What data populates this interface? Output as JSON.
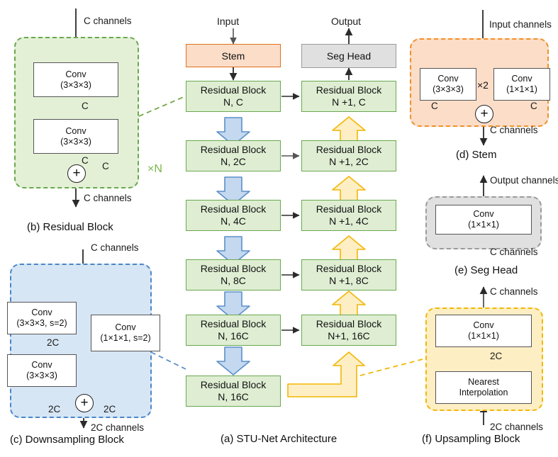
{
  "figure": {
    "title": "STU-Net Architecture figure",
    "colors": {
      "residual_fill": "#dfeed3",
      "residual_border": "#6aa84f",
      "stem_fill": "#fbddc8",
      "stem_border": "#e2701c",
      "seghead_fill": "#e0e0e0",
      "seghead_border": "#9a9a9a",
      "downsample_fill": "#d7e6f5",
      "downsample_border": "#4a86c8",
      "upsample_fill": "#fdeec4",
      "upsample_border": "#f2b705",
      "down_arrow_fill": "#c4d8ef",
      "down_arrow_border": "#5b8fc9",
      "up_arrow_fill": "#fdeec4",
      "up_arrow_border": "#f2b705"
    }
  },
  "panel_b": {
    "caption": "(b) Residual Block",
    "in_label": "C channels",
    "out_label": "C channels",
    "repeat_label": "×N",
    "conv1": {
      "line1": "Conv",
      "line2": "(3×3×3)"
    },
    "conv2": {
      "line1": "Conv",
      "line2": "(3×3×3)"
    },
    "mid1": "C",
    "mid2": "C",
    "skip": "C",
    "add": "+"
  },
  "panel_c": {
    "caption": "(c) Downsampling Block",
    "in_label": "C channels",
    "out_label": "2C channels",
    "conv1": {
      "line1": "Conv",
      "line2": "(3×3×3, s=2)"
    },
    "conv2": {
      "line1": "Conv",
      "line2": "(3×3×3)"
    },
    "conv3": {
      "line1": "Conv",
      "line2": "(1×1×1, s=2)"
    },
    "mid1": "2C",
    "left_join": "2C",
    "right_join": "2C",
    "add": "+"
  },
  "panel_a": {
    "caption": "(a) STU-Net Architecture",
    "input_label": "Input",
    "output_label": "Output",
    "stem_label": "Stem",
    "seghead_label": "Seg Head",
    "encoder": [
      {
        "line1": "Residual Block",
        "line2": "N, C"
      },
      {
        "line1": "Residual Block",
        "line2": "N, 2C"
      },
      {
        "line1": "Residual Block",
        "line2": "N, 4C"
      },
      {
        "line1": "Residual Block",
        "line2": "N, 8C"
      },
      {
        "line1": "Residual Block",
        "line2": "N, 16C"
      },
      {
        "line1": "Residual Block",
        "line2": "N, 16C"
      }
    ],
    "decoder": [
      {
        "line1": "Residual Block",
        "line2": "N +1, C"
      },
      {
        "line1": "Residual Block",
        "line2": "N +1, 2C"
      },
      {
        "line1": "Residual Block",
        "line2": "N +1, 4C"
      },
      {
        "line1": "Residual Block",
        "line2": "N +1, 8C"
      },
      {
        "line1": "Residual Block",
        "line2": "N+1, 16C"
      }
    ]
  },
  "panel_d": {
    "caption": "(d) Stem",
    "in_label": "Input channels",
    "out_label": "C channels",
    "conv_left": {
      "line1": "Conv",
      "line2": "(3×3×3)"
    },
    "conv_right": {
      "line1": "Conv",
      "line2": "(1×1×1)"
    },
    "repeat_label": "×2",
    "left_join": "C",
    "right_join": "C",
    "add": "+"
  },
  "panel_e": {
    "caption": "(e) Seg Head",
    "in_label": "C channels",
    "out_label": "Output channels",
    "conv": {
      "line1": "Conv",
      "line2": "(1×1×1)"
    }
  },
  "panel_f": {
    "caption": "(f) Upsampling Block",
    "in_label": "2C channels",
    "out_label": "C channels",
    "conv": {
      "line1": "Conv",
      "line2": "(1×1×1)"
    },
    "interp": {
      "line1": "Nearest",
      "line2": "Interpolation"
    },
    "mid": "2C"
  }
}
